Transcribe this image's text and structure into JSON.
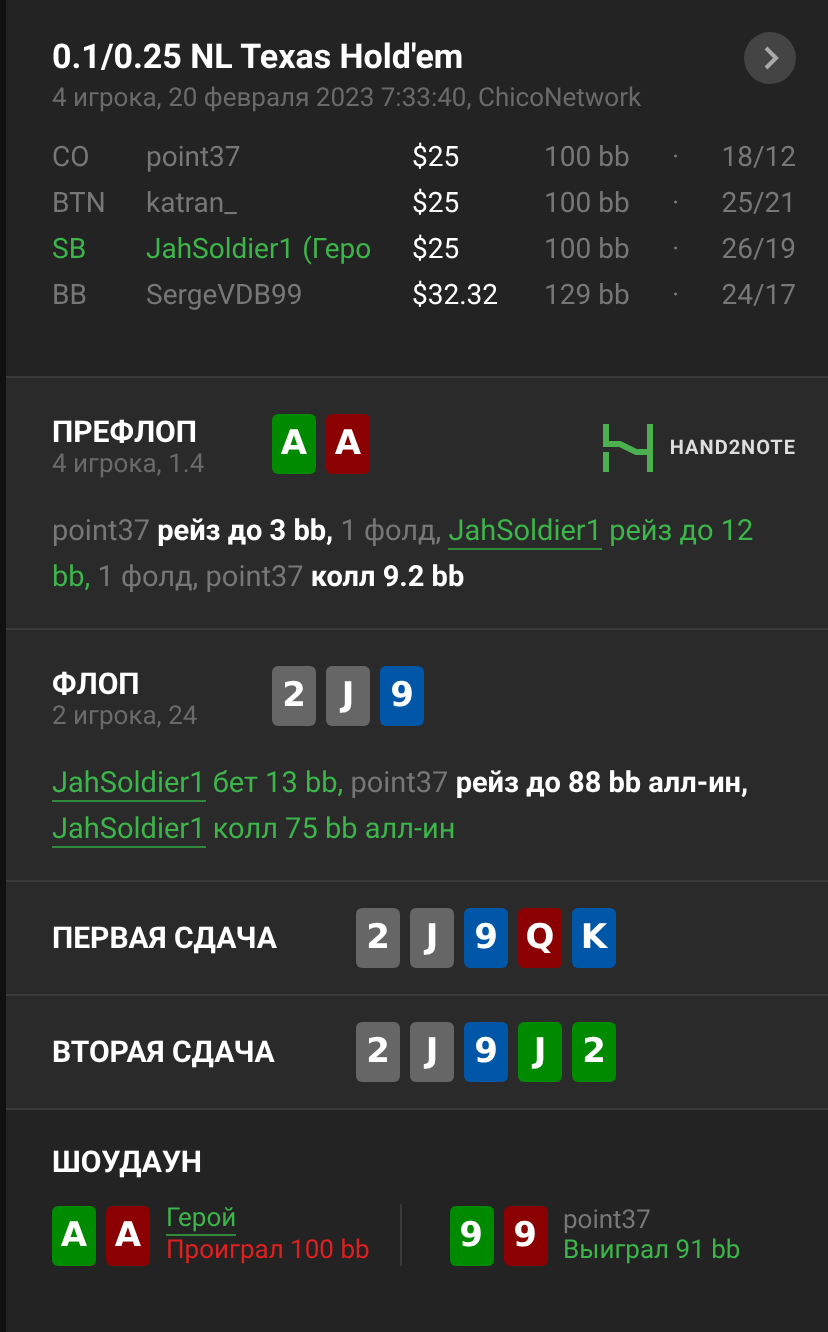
{
  "header": {
    "title": "0.1/0.25 NL Texas Hold'em",
    "subtitle": "4 игрока, 20 февраля 2023 7:33:40, ChicoNetwork"
  },
  "players": [
    {
      "position": "CO",
      "name": "point37",
      "hero": false,
      "stack": "$25",
      "bb": "100 bb",
      "separator": "·",
      "stats": "18/12"
    },
    {
      "position": "BTN",
      "name": "katran_",
      "hero": false,
      "stack": "$25",
      "bb": "100 bb",
      "separator": "·",
      "stats": "25/21"
    },
    {
      "position": "SB",
      "name": "JahSoldier1",
      "hero": true,
      "suffix": "(Геро",
      "stack": "$25",
      "bb": "100 bb",
      "separator": "·",
      "stats": "26/19"
    },
    {
      "position": "BB",
      "name": "SergeVDB99",
      "hero": false,
      "stack": "$32.32",
      "bb": "129 bb",
      "separator": "·",
      "stats": "24/17"
    }
  ],
  "streets": [
    {
      "kind": "detailed",
      "title": "ПРЕФЛОП",
      "subtitle": "4 игрока, 1.4",
      "logo": "HAND2NOTE",
      "cards": [
        {
          "rank": "A",
          "color": "#008a00"
        },
        {
          "rank": "A",
          "color": "#8b0000"
        }
      ],
      "actions": [
        {
          "text": "point37",
          "kind": "player"
        },
        {
          "text": "рейз до 3 bb,",
          "kind": "action"
        },
        {
          "text": "1 фолд,",
          "kind": "muted"
        },
        {
          "text": "JahSoldier1",
          "kind": "hero"
        },
        {
          "text": "рейз до 12 bb,",
          "kind": "hero_action"
        },
        {
          "text": "1 фолд,",
          "kind": "muted"
        },
        {
          "text": "point37",
          "kind": "player"
        },
        {
          "text": "колл 9.2 bb",
          "kind": "action"
        }
      ]
    },
    {
      "kind": "detailed",
      "title": "ФЛОП",
      "subtitle": "2 игрока, 24",
      "cards": [
        {
          "rank": "2",
          "color": "#666666"
        },
        {
          "rank": "J",
          "color": "#666666"
        },
        {
          "rank": "9",
          "color": "#0057a8"
        }
      ],
      "actions": [
        {
          "text": "JahSoldier1",
          "kind": "hero"
        },
        {
          "text": "бет 13 bb,",
          "kind": "hero_action"
        },
        {
          "text": "point37",
          "kind": "player"
        },
        {
          "text": "рейз до 88 bb алл-ин,",
          "kind": "action"
        },
        {
          "text": "JahSoldier1",
          "kind": "hero"
        },
        {
          "text": "колл 75 bb алл-ин",
          "kind": "hero_action"
        }
      ]
    },
    {
      "kind": "board",
      "title": "ПЕРВАЯ СДАЧА",
      "cards": [
        {
          "rank": "2",
          "color": "#666666"
        },
        {
          "rank": "J",
          "color": "#666666"
        },
        {
          "rank": "9",
          "color": "#0057a8"
        },
        {
          "rank": "Q",
          "color": "#8b0000"
        },
        {
          "rank": "K",
          "color": "#0057a8"
        }
      ]
    },
    {
      "kind": "board",
      "title": "ВТОРАЯ СДАЧА",
      "cards": [
        {
          "rank": "2",
          "color": "#666666"
        },
        {
          "rank": "J",
          "color": "#666666"
        },
        {
          "rank": "9",
          "color": "#0057a8"
        },
        {
          "rank": "J",
          "color": "#008a00"
        },
        {
          "rank": "2",
          "color": "#008a00"
        }
      ]
    }
  ],
  "showdown": {
    "title": "ШОУДАУН",
    "hands": [
      {
        "name": "Герой",
        "hero": true,
        "won": false,
        "result": "Проиграл 100 bb",
        "cards": [
          {
            "rank": "A",
            "color": "#008a00"
          },
          {
            "rank": "A",
            "color": "#8b0000"
          }
        ]
      },
      {
        "name": "point37",
        "hero": false,
        "won": true,
        "result": "Выиграл 91 bb",
        "cards": [
          {
            "rank": "9",
            "color": "#008a00"
          },
          {
            "rank": "9",
            "color": "#8b0000"
          }
        ]
      }
    ]
  }
}
